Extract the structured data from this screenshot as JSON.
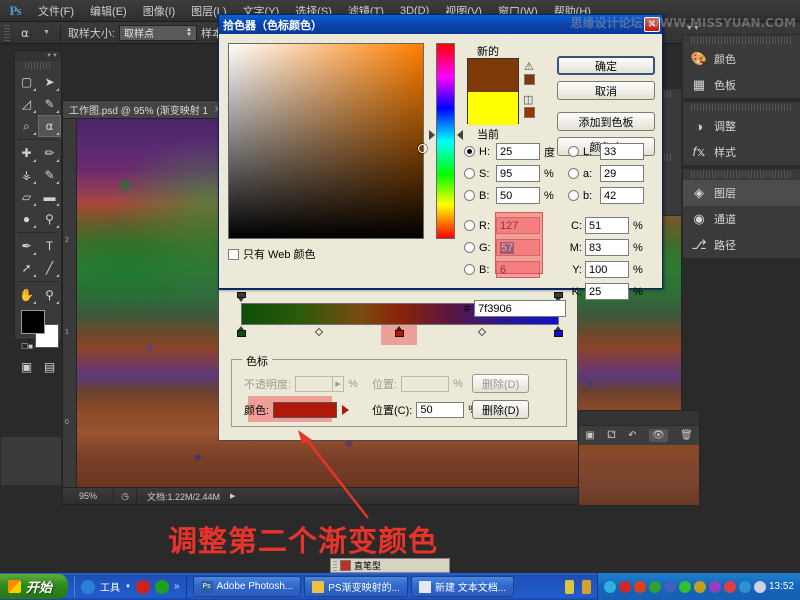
{
  "app": {
    "logo": "Ps",
    "menus": [
      {
        "label": "文件(F)"
      },
      {
        "label": "编辑(E)"
      },
      {
        "label": "图像(I)"
      },
      {
        "label": "图层(L)"
      },
      {
        "label": "文字(Y)"
      },
      {
        "label": "选择(S)"
      },
      {
        "label": "滤镜(T)"
      },
      {
        "label": "3D(D)"
      },
      {
        "label": "视图(V)"
      },
      {
        "label": "窗口(W)"
      },
      {
        "label": "帮助(H)"
      }
    ]
  },
  "options_bar": {
    "tool_icon": "eyedropper-icon",
    "sample_size_label": "取样大小:",
    "sample_size_value": "取样点",
    "sample_label": "样本:"
  },
  "toolbox": {
    "tools": [
      {
        "name": "rectangular-marquee-tool",
        "glyph": "▭"
      },
      {
        "name": "move-tool",
        "glyph": "➤"
      },
      {
        "name": "lasso-tool",
        "glyph": "◺"
      },
      {
        "name": "quick-selection-tool",
        "glyph": "✎"
      },
      {
        "name": "crop-tool",
        "glyph": "⌗"
      },
      {
        "name": "eyedropper-tool",
        "glyph": "⚲"
      },
      {
        "name": "spot-healing-tool",
        "glyph": "✛"
      },
      {
        "name": "brush-tool",
        "glyph": "✐"
      },
      {
        "name": "clone-stamp-tool",
        "glyph": "⚱"
      },
      {
        "name": "history-brush-tool",
        "glyph": "✏"
      },
      {
        "name": "eraser-tool",
        "glyph": "▱"
      },
      {
        "name": "gradient-tool",
        "glyph": "▬"
      },
      {
        "name": "blur-tool",
        "glyph": "💧"
      },
      {
        "name": "dodge-tool",
        "glyph": "🔍"
      },
      {
        "name": "pen-tool",
        "glyph": "✒"
      },
      {
        "name": "type-tool",
        "glyph": "T"
      },
      {
        "name": "path-selection-tool",
        "glyph": "➚"
      },
      {
        "name": "line-tool",
        "glyph": "╱"
      },
      {
        "name": "hand-tool",
        "glyph": "✋"
      },
      {
        "name": "zoom-tool",
        "glyph": "🔎"
      }
    ],
    "foreground_color": "#000000",
    "background_color": "#ffffff"
  },
  "document": {
    "tab_title": "工作图.psd @ 95% (渐变映射 1",
    "status_zoom": "95%",
    "status_doc": "文档:1.22M/2.44M",
    "ruler_marks": [
      "2",
      "1",
      "0"
    ]
  },
  "right_panels": {
    "narrow_items": [
      {
        "name": "history-panel",
        "glyph": "⧉"
      },
      {
        "name": "actions-panel",
        "glyph": "▶"
      },
      {
        "name": "navigator-panel",
        "glyph": "✳"
      },
      {
        "name": "histogram-panel",
        "glyph": "▲"
      }
    ],
    "groups": [
      {
        "items": [
          {
            "label": "颜色",
            "icon": "color-palette-icon",
            "glyph": "🎨",
            "active": false
          },
          {
            "label": "色板",
            "icon": "swatches-icon",
            "glyph": "▦",
            "active": false
          }
        ]
      },
      {
        "items": [
          {
            "label": "调整",
            "icon": "adjustments-icon",
            "glyph": "◑",
            "active": false
          },
          {
            "label": "样式",
            "icon": "styles-icon",
            "glyph": "fx",
            "active": false
          }
        ]
      },
      {
        "items": [
          {
            "label": "图层",
            "icon": "layers-icon",
            "glyph": "◈",
            "active": true
          },
          {
            "label": "通道",
            "icon": "channels-icon",
            "glyph": "◉",
            "active": false
          },
          {
            "label": "路径",
            "icon": "paths-icon",
            "glyph": "⌇",
            "active": false
          }
        ]
      }
    ]
  },
  "color_picker": {
    "title": "拾色器（色标颜色）",
    "close_label": "✕",
    "new_label": "新的",
    "current_label": "当前",
    "new_color": "#7f3906",
    "current_color": "#ffff00",
    "web_only_label": "只有 Web 颜色",
    "buttons": [
      {
        "label": "确定",
        "name": "ok-button",
        "default": true
      },
      {
        "label": "取消",
        "name": "cancel-button",
        "default": false
      },
      {
        "label": "添加到色板",
        "name": "add-to-swatches-button",
        "default": false
      },
      {
        "label": "颜色库",
        "name": "color-libraries-button",
        "default": false
      }
    ],
    "hsb": [
      {
        "key": "H:",
        "value": "25",
        "unit": "度",
        "selected": true
      },
      {
        "key": "S:",
        "value": "95",
        "unit": "%",
        "selected": false
      },
      {
        "key": "B:",
        "value": "50",
        "unit": "%",
        "selected": false
      }
    ],
    "rgb": [
      {
        "key": "R:",
        "value": "127",
        "unit": "",
        "selected": false
      },
      {
        "key": "G:",
        "value": "57",
        "unit": "",
        "selected": false
      },
      {
        "key": "B:",
        "value": "6",
        "unit": "",
        "selected": false
      }
    ],
    "lab": [
      {
        "key": "L:",
        "value": "33",
        "unit": "",
        "selected": false
      },
      {
        "key": "a:",
        "value": "29",
        "unit": "",
        "selected": false
      },
      {
        "key": "b:",
        "value": "42",
        "unit": "",
        "selected": false
      }
    ],
    "cmyk": [
      {
        "key": "C:",
        "value": "51",
        "unit": "%"
      },
      {
        "key": "M:",
        "value": "83",
        "unit": "%"
      },
      {
        "key": "Y:",
        "value": "100",
        "unit": "%"
      },
      {
        "key": "K:",
        "value": "25",
        "unit": "%"
      }
    ],
    "hex_prefix": "#",
    "hex_value": "7f3906"
  },
  "gradient_editor": {
    "colorstop_legend": "色标",
    "opacity_label": "不透明度:",
    "opacity_value": "",
    "opacity_unit": "%",
    "opacity_location_label": "位置:",
    "opacity_location_value": "",
    "opacity_location_unit": "%",
    "delete_opacity_label": "删除(D)",
    "color_label": "颜色:",
    "color_value": "#b01808",
    "location_label": "位置(C):",
    "location_value": "50",
    "location_unit": "%",
    "delete_color_label": "删除(D)",
    "gradient_stops": [
      {
        "position": 0,
        "color": "#0d4d0a"
      },
      {
        "position": 50,
        "color": "#b01808"
      },
      {
        "position": 100,
        "color": "#1010cc"
      }
    ],
    "midpoints": [
      25,
      75
    ]
  },
  "annotation": {
    "text": "调整第二个渐变颜色",
    "color": "#e8332a"
  },
  "float_toolbar": {
    "label": "直笔型"
  },
  "watermark": {
    "text": "思缘设计论坛",
    "url": "WWW.MISSYUAN.COM"
  },
  "taskbar": {
    "start_label": "开始",
    "quick_launch": [
      {
        "name": "ie-icon",
        "color": "#2d7fd4"
      },
      {
        "name": "tools-label",
        "color": "#cccccc"
      },
      {
        "name": "dropdown-caret",
        "color": "#dddddd"
      },
      {
        "name": "opera-icon",
        "color": "#d02020"
      },
      {
        "name": "refresh-icon",
        "color": "#20a020"
      }
    ],
    "tools_label": "工具",
    "tasks": [
      {
        "label": "Adobe Photosh...",
        "icon": "photoshop-icon",
        "color": "#2a5f9e"
      },
      {
        "label": "PS渐变映射的...",
        "icon": "folder-icon",
        "color": "#f0c040"
      },
      {
        "label": "新建 文本文档...",
        "icon": "notepad-icon",
        "color": "#e8e8f0"
      }
    ],
    "tray_icons": [
      {
        "name": "tray-icon-1",
        "color": "#2fb0e0"
      },
      {
        "name": "tray-icon-2",
        "color": "#d02828"
      },
      {
        "name": "tray-icon-3",
        "color": "#e04020"
      },
      {
        "name": "tray-icon-4",
        "color": "#30a030"
      },
      {
        "name": "tray-icon-5",
        "color": "#4060c0"
      },
      {
        "name": "tray-icon-6",
        "color": "#30c030"
      },
      {
        "name": "tray-icon-7",
        "color": "#c0a020"
      },
      {
        "name": "tray-icon-8",
        "color": "#9040c0"
      },
      {
        "name": "tray-icon-9",
        "color": "#e04040"
      },
      {
        "name": "tray-icon-10",
        "color": "#3090d0"
      },
      {
        "name": "tray-icon-11",
        "color": "#d0d0e0"
      }
    ],
    "clock": "13:52"
  }
}
